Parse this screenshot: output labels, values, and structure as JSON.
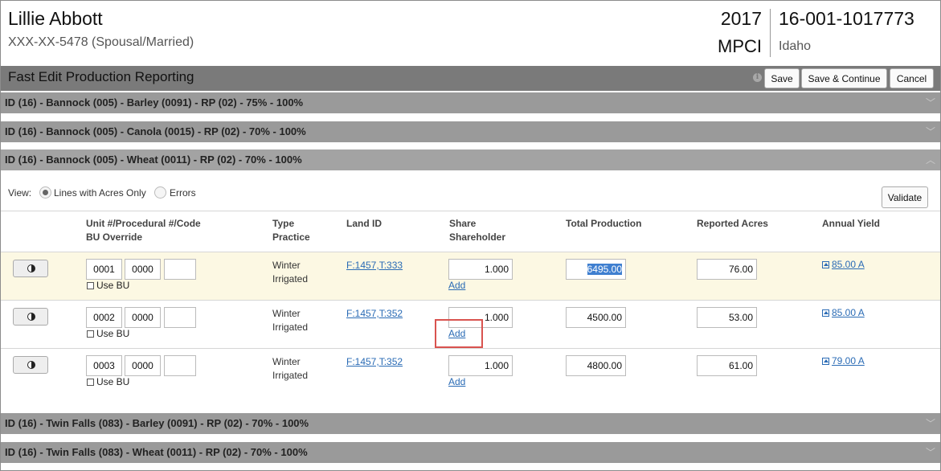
{
  "header": {
    "name": "Lillie Abbott",
    "ssn": "XXX-XX-5478 (Spousal/Married)",
    "year": "2017",
    "plan": "MPCI",
    "policy": "16-001-1017773",
    "state": "Idaho"
  },
  "titlebar": {
    "title": "Fast Edit Production Reporting",
    "info_icon": "i",
    "save": "Save",
    "save_continue": "Save & Continue",
    "cancel": "Cancel"
  },
  "sections": [
    {
      "label": "ID (16) - Bannock (005) - Barley (0091) - RP (02) - 75% - 100%",
      "chevron": "﹀"
    },
    {
      "label": "ID (16) - Bannock (005) - Canola (0015) - RP (02) - 70% - 100%",
      "chevron": "﹀"
    },
    {
      "label": "ID (16) - Bannock (005) - Wheat (0011) - RP (02) - 70% - 100%",
      "chevron": "︿"
    },
    {
      "label": "ID (16) - Twin Falls (083) - Barley (0091) - RP (02) - 70% - 100%",
      "chevron": "﹀"
    },
    {
      "label": "ID (16) - Twin Falls (083) - Wheat (0011) - RP (02) - 70% - 100%",
      "chevron": "﹀"
    }
  ],
  "view": {
    "label": "View:",
    "option_lines": "Lines with Acres Only",
    "option_errors": "Errors",
    "selected": "Lines with Acres Only",
    "validate": "Validate"
  },
  "table": {
    "headers": {
      "unit": "Unit #/Procedural #/Code",
      "bu_override": "BU Override",
      "type": "Type",
      "practice": "Practice",
      "land_id": "Land ID",
      "share": "Share",
      "shareholder": "Shareholder",
      "total_production": "Total Production",
      "reported_acres": "Reported Acres",
      "annual_yield": "Annual Yield"
    },
    "rows": [
      {
        "unit": "0001",
        "procedural": "0000",
        "code": "",
        "use_bu": "Use BU",
        "type": "Winter",
        "practice": "Irrigated",
        "land_id": "F:1457,T:333",
        "share": "1.000",
        "add": "Add",
        "total_production": "6495.00",
        "reported_acres": "76.00",
        "annual_yield": "85.00 A"
      },
      {
        "unit": "0002",
        "procedural": "0000",
        "code": "",
        "use_bu": "Use BU",
        "type": "Winter",
        "practice": "Irrigated",
        "land_id": "F:1457,T:352",
        "share": "1.000",
        "add": "Add",
        "total_production": "4500.00",
        "reported_acres": "53.00",
        "annual_yield": "85.00 A"
      },
      {
        "unit": "0003",
        "procedural": "0000",
        "code": "",
        "use_bu": "Use BU",
        "type": "Winter",
        "practice": "Irrigated",
        "land_id": "F:1457,T:352",
        "share": "1.000",
        "add": "Add",
        "total_production": "4800.00",
        "reported_acres": "61.00",
        "annual_yield": "79.00 A"
      }
    ]
  },
  "colors": {
    "titlebar_bg": "#7a7a7a",
    "section_bg": "#9a9a9a",
    "row_highlight": "#fcf8e3",
    "link": "#2a6bb5",
    "annotation_box": "#d9534f",
    "selection": "#3f7fd0"
  },
  "icons": {
    "row_toggle": "half-circle-icon",
    "info": "info-icon",
    "yield": "up-arrow-box-icon",
    "section_collapsed": "chevron-down-icon",
    "section_expanded": "chevron-up-icon"
  }
}
